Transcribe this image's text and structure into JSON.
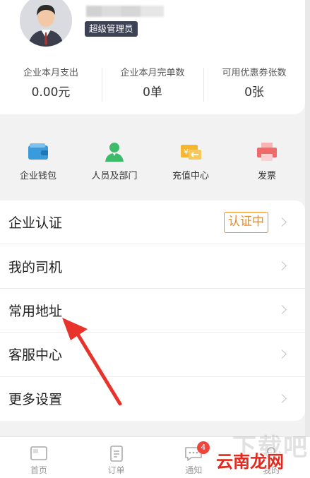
{
  "profile": {
    "role_badge": "超级管理员",
    "stats": [
      {
        "label": "企业本月支出",
        "value": "0.00元"
      },
      {
        "label": "企业本月完单数",
        "value": "0单"
      },
      {
        "label": "可用优惠券张数",
        "value": "0张"
      }
    ]
  },
  "quick_actions": [
    {
      "label": "企业钱包",
      "icon": "wallet-icon"
    },
    {
      "label": "人员及部门",
      "icon": "people-icon"
    },
    {
      "label": "充值中心",
      "icon": "recharge-card-icon"
    },
    {
      "label": "发票",
      "icon": "printer-invoice-icon"
    }
  ],
  "menu": [
    {
      "label": "企业认证",
      "tag": "认证中"
    },
    {
      "label": "我的司机"
    },
    {
      "label": "常用地址"
    },
    {
      "label": "客服中心"
    },
    {
      "label": "更多设置"
    }
  ],
  "tabbar": [
    {
      "label": "首页",
      "icon": "home-icon"
    },
    {
      "label": "订单",
      "icon": "order-icon"
    },
    {
      "label": "通知",
      "icon": "notification-icon",
      "badge": "4"
    },
    {
      "label": "我的",
      "icon": "profile-icon"
    }
  ],
  "watermark": {
    "text": "云南龙网",
    "ghost_text": "下载吧"
  },
  "colors": {
    "accent_orange": "#f08a22",
    "badge_red": "#f1443b",
    "arrow_red": "#e8332b",
    "wallet_blue": "#3a9bdc",
    "people_green": "#3dba6a",
    "recharge_yellow": "#f5b731",
    "invoice_red": "#f06a6a"
  }
}
